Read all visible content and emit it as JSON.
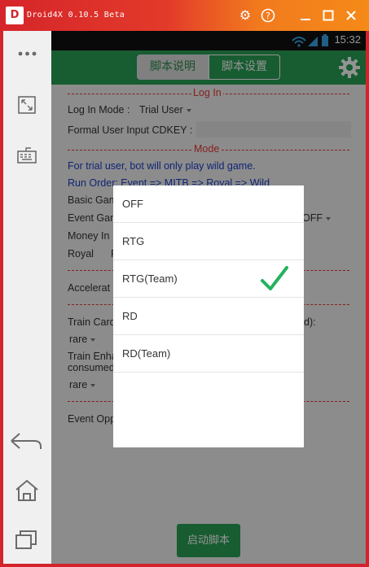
{
  "window": {
    "title": "Droid4X 0.10.5 Beta",
    "logo_text": "D"
  },
  "status_bar": {
    "time": "15:32"
  },
  "app_bar": {
    "tabs": [
      {
        "label": "脚本说明",
        "selected": false
      },
      {
        "label": "脚本设置",
        "selected": true
      }
    ]
  },
  "sections": {
    "login": "Log In",
    "mode": "Mode"
  },
  "login": {
    "mode_label": "Log In Mode :",
    "mode_value": "Trial User",
    "cdkey_label": "Formal User Input CDKEY :"
  },
  "mode": {
    "trial_note": "For trial user, bot will only play wild game.",
    "run_order": "Run Order:  Event => MITB => Royal => Wild",
    "basic_game": "Basic Gam",
    "event_game": "Event Gam",
    "event_value": "OFF",
    "money_in": "Money In",
    "royal": "Royal",
    "royal_extra": "R"
  },
  "more": {
    "accelerate": "Accelerat",
    "train_card": "Train Card",
    "train_card_suffix": "d):",
    "train_card_value": "rare",
    "train_enh_1": "Train Enha",
    "train_enh_2": "consumed",
    "train_enh_value": "rare",
    "event_opp": "Event Opp"
  },
  "start_button": "启动脚本",
  "dialog": {
    "options": [
      {
        "label": "OFF",
        "selected": false
      },
      {
        "label": "RTG",
        "selected": false
      },
      {
        "label": "RTG(Team)",
        "selected": true
      },
      {
        "label": "RD",
        "selected": false
      },
      {
        "label": "RD(Team)",
        "selected": false
      }
    ],
    "check_color": "#22b35e"
  },
  "colors": {
    "accent_green": "#2a9f55",
    "separator_red": "#e53935",
    "note_blue": "#1a3ec9"
  }
}
